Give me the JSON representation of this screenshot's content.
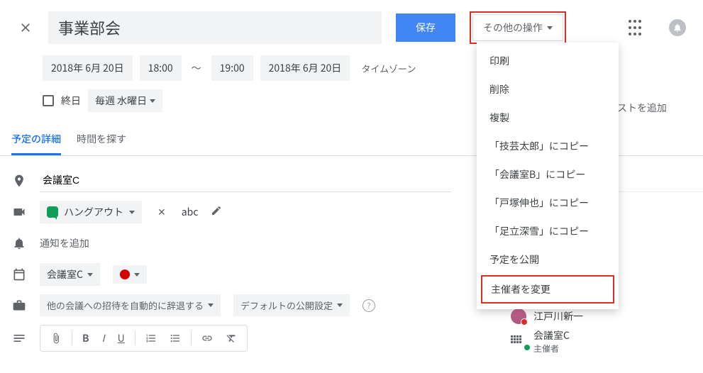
{
  "header": {
    "title_value": "事業部会",
    "save_label": "保存",
    "more_label": "その他の操作"
  },
  "datetime": {
    "start_date": "2018年 6月 20日",
    "start_time": "18:00",
    "separator": "〜",
    "end_time": "19:00",
    "end_date": "2018年 6月 20日",
    "timezone_link": "タイムゾーン",
    "allday_label": "終日",
    "recurrence": "毎週 水曜日"
  },
  "tabs": {
    "details": "予定の詳細",
    "findtime": "時間を探す"
  },
  "details": {
    "location_value": "会議室C",
    "hangout_label": "ハングアウト",
    "hangout_code": "abc",
    "add_notification": "通知を追加",
    "calendar_selected": "会議室C",
    "busy_label": "他の会議への招待を自動的に辞退する",
    "visibility_label": "デフォルトの公開設定"
  },
  "more_menu": {
    "items": [
      "印刷",
      "削除",
      "複製",
      "「技芸太郎」にコピー",
      "「会議室B」にコピー",
      "「戸塚伸也」にコピー",
      "「足立深雪」にコピー",
      "予定を公開",
      "主催者を変更"
    ]
  },
  "right": {
    "add_guests": "ゲストを追加",
    "guests": [
      {
        "name": "江戸川新一",
        "status": "declined"
      },
      {
        "name": "会議室C",
        "sub": "主催者",
        "status": "accepted",
        "is_room": true
      }
    ]
  },
  "colors": {
    "accent_blue": "#4285f4",
    "highlight_red": "#d93025",
    "event_color": "#d50000"
  }
}
